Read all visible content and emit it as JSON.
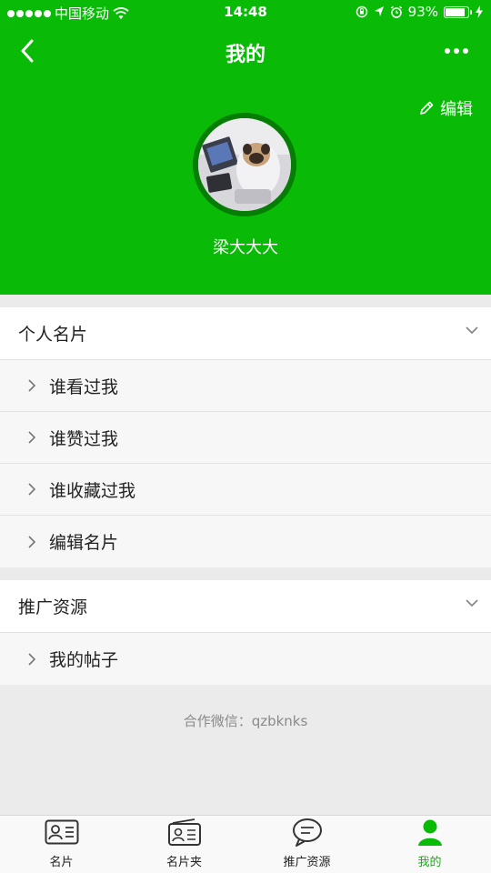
{
  "status_bar": {
    "carrier": "中国移动",
    "time": "14:48",
    "battery_percent": "93%",
    "battery_level": 0.93
  },
  "nav": {
    "title": "我的"
  },
  "profile": {
    "edit_label": "编辑",
    "user_name": "梁大大大"
  },
  "sections": [
    {
      "title": "个人名片",
      "items": [
        "谁看过我",
        "谁赞过我",
        "谁收藏过我",
        "编辑名片"
      ]
    },
    {
      "title": "推广资源",
      "items": [
        "我的帖子"
      ]
    }
  ],
  "footer": {
    "note": "合作微信：qzbknks"
  },
  "tabbar": {
    "tabs": [
      {
        "label": "名片",
        "icon": "card-icon",
        "active": false
      },
      {
        "label": "名片夹",
        "icon": "card-holder-icon",
        "active": false
      },
      {
        "label": "推广资源",
        "icon": "message-icon",
        "active": false
      },
      {
        "label": "我的",
        "icon": "user-icon",
        "active": true
      }
    ]
  },
  "colors": {
    "brand": "#09bb07",
    "background": "#ebebeb"
  }
}
